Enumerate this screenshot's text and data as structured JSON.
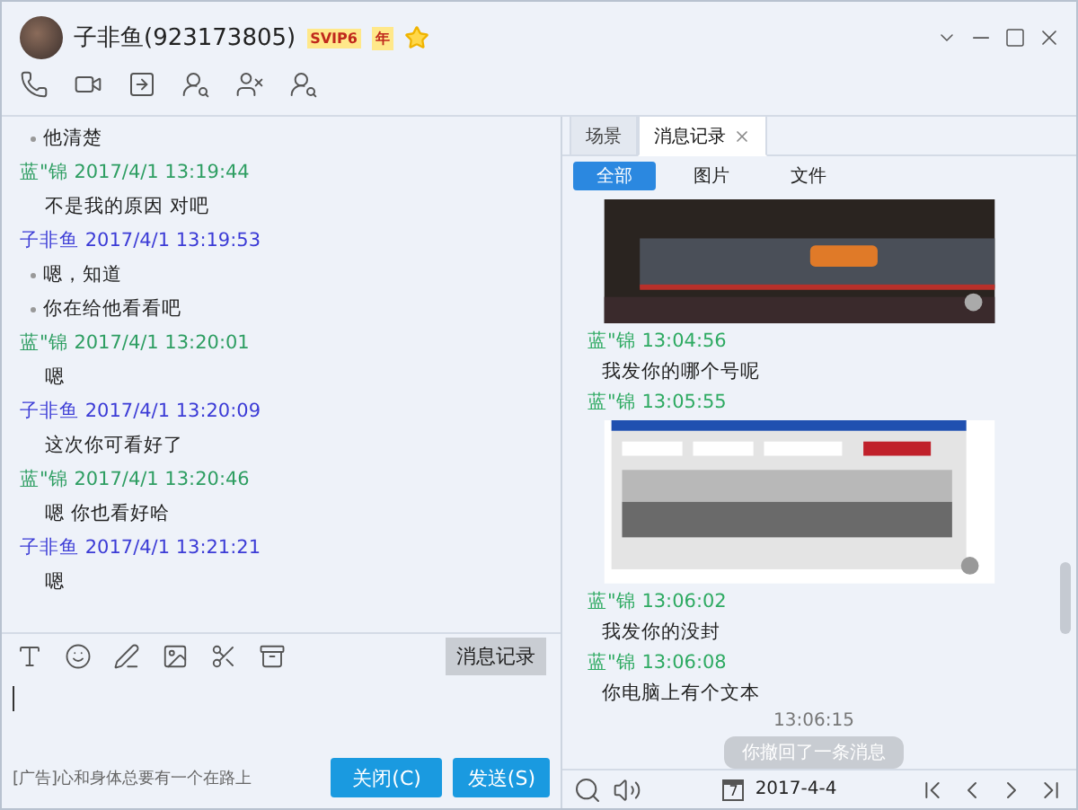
{
  "window": {
    "title": "子非鱼(923173805)",
    "badge": "SVIP6",
    "badge_suffix": "年"
  },
  "chat": {
    "messages": [
      {
        "kind": "text",
        "text": "他清楚",
        "bullet": true
      },
      {
        "kind": "header",
        "sender": "蓝\"锦",
        "time": "2017/4/1 13:19:44",
        "color": "#2e9e62"
      },
      {
        "kind": "text",
        "text": "不是我的原因 对吧",
        "bullet": false
      },
      {
        "kind": "header",
        "sender": "子非鱼",
        "time": "2017/4/1 13:19:53",
        "color": "#3b3bd6"
      },
      {
        "kind": "text",
        "text": "嗯，知道",
        "bullet": true
      },
      {
        "kind": "text",
        "text": "你在给他看看吧",
        "bullet": true
      },
      {
        "kind": "header",
        "sender": "蓝\"锦",
        "time": "2017/4/1 13:20:01",
        "color": "#2e9e62"
      },
      {
        "kind": "text",
        "text": "嗯",
        "bullet": false
      },
      {
        "kind": "header",
        "sender": "子非鱼",
        "time": "2017/4/1 13:20:09",
        "color": "#3b3bd6"
      },
      {
        "kind": "text",
        "text": "这次你可看好了",
        "bullet": false
      },
      {
        "kind": "header",
        "sender": "蓝\"锦",
        "time": "2017/4/1 13:20:46",
        "color": "#2e9e62"
      },
      {
        "kind": "text",
        "text": "嗯 你也看好哈",
        "bullet": false
      },
      {
        "kind": "header",
        "sender": "子非鱼",
        "time": "2017/4/1 13:21:21",
        "color": "#3b3bd6"
      },
      {
        "kind": "text",
        "text": "嗯",
        "bullet": false
      }
    ]
  },
  "composer": {
    "history_button": "消息记录",
    "ad": "[广告]心和身体总要有一个在路上",
    "close_button": "关闭(C)",
    "send_button": "发送(S)"
  },
  "history": {
    "tabs": [
      {
        "label": "场景",
        "selected": false,
        "closable": false
      },
      {
        "label": "消息记录",
        "selected": true,
        "closable": true
      }
    ],
    "filters": [
      {
        "label": "全部",
        "selected": true
      },
      {
        "label": "图片",
        "selected": false
      },
      {
        "label": "文件",
        "selected": false
      }
    ],
    "messages": [
      {
        "kind": "picture"
      },
      {
        "kind": "header",
        "sender": "蓝\"锦",
        "time": "13:04:56"
      },
      {
        "kind": "text",
        "text": "我发你的哪个号呢"
      },
      {
        "kind": "header",
        "sender": "蓝\"锦",
        "time": "13:05:55"
      },
      {
        "kind": "picture"
      },
      {
        "kind": "header",
        "sender": "蓝\"锦",
        "time": "13:06:02"
      },
      {
        "kind": "text",
        "text": "我发你的没封"
      },
      {
        "kind": "header",
        "sender": "蓝\"锦",
        "time": "13:06:08"
      },
      {
        "kind": "text",
        "text": "你电脑上有个文本"
      },
      {
        "kind": "time",
        "text": "13:06:15"
      },
      {
        "kind": "notice",
        "text": "你撤回了一条消息"
      }
    ],
    "date": "2017-4-4",
    "calendar_day": "7"
  }
}
